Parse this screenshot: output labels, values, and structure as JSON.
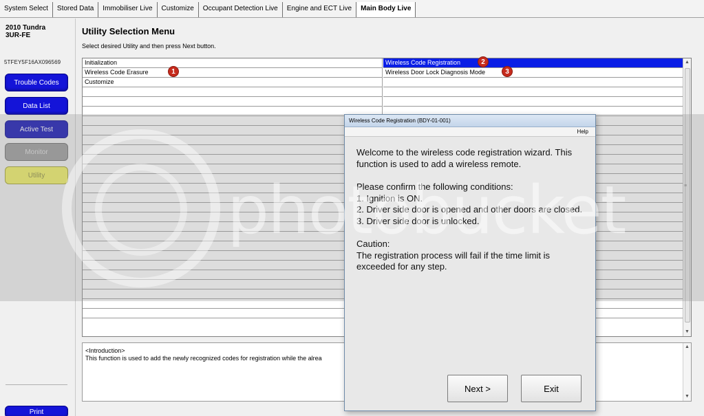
{
  "tabs": [
    {
      "label": "System Select",
      "active": false
    },
    {
      "label": "Stored Data",
      "active": false
    },
    {
      "label": "Immobiliser Live",
      "active": false
    },
    {
      "label": "Customize",
      "active": false
    },
    {
      "label": "Occupant Detection Live",
      "active": false
    },
    {
      "label": "Engine and ECT Live",
      "active": false
    },
    {
      "label": "Main Body Live",
      "active": true
    }
  ],
  "sidebar": {
    "vehicle_line1": "2010 Tundra",
    "vehicle_line2": "3UR-FE",
    "vin": "5TFEY5F16AX096569",
    "buttons": [
      {
        "label": "Trouble Codes",
        "state": "enabled"
      },
      {
        "label": "Data List",
        "state": "enabled"
      },
      {
        "label": "Active Test",
        "state": "enabled"
      },
      {
        "label": "Monitor",
        "state": "disabled"
      },
      {
        "label": "Utility",
        "state": "active"
      }
    ],
    "print_label": "Print"
  },
  "main": {
    "title": "Utility Selection Menu",
    "subtitle": "Select desired Utility and then press Next button.",
    "grid": {
      "col1": [
        "Initialization",
        "Wireless Code Erasure",
        "Customize"
      ],
      "col2": [
        "Wireless Code Registration",
        "Wireless Door Lock Diagnosis Mode"
      ],
      "selected": "Wireless Code Registration",
      "scroll_up": "▲",
      "scroll_down": "▼",
      "grip": "≡"
    },
    "intro": {
      "heading": "<Introduction>",
      "text": "This function is used to add the newly recognized codes for registration while the alrea"
    }
  },
  "markers": [
    "1",
    "2",
    "3"
  ],
  "dialog": {
    "title": "Wireless Code Registration (BDY-01-001)",
    "help": "Help",
    "para1": "Welcome to the wireless code registration wizard. This function is used to add a wireless remote.",
    "para2_intro": "Please confirm the following conditions:",
    "cond1": "1. Ignition is ON.",
    "cond2": "2. Driver side door is opened and other doors are closed.",
    "cond3": "3. Driver side door is unlocked.",
    "caution_head": "Caution:",
    "caution_text": "The registration process will fail if the time limit is exceeded for any step.",
    "next_label": "Next >",
    "exit_label": "Exit"
  },
  "watermark": "photobucket",
  "colors": {
    "selection": "#0a1ee6",
    "button_blue": "#1414d8",
    "button_disabled": "#9a9a9a",
    "button_active": "#f0f060",
    "marker_red": "#c62b1d"
  }
}
